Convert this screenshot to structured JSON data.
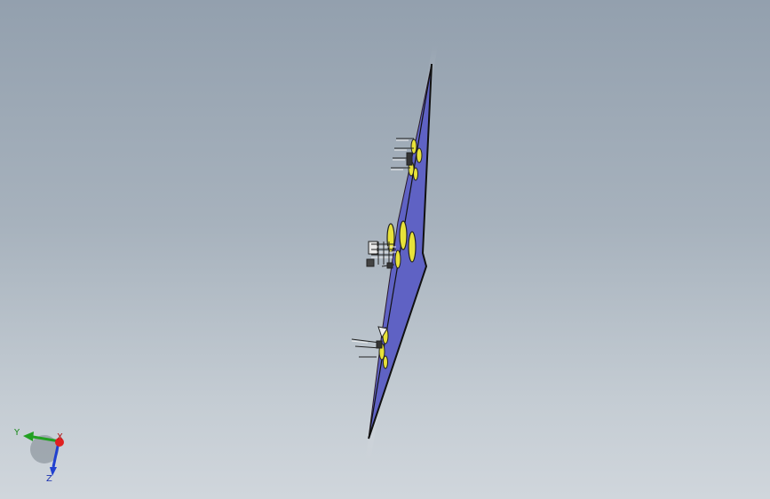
{
  "viewport": {
    "background_top": "#93a0ae",
    "background_bottom": "#d0d6dc"
  },
  "model": {
    "name": "pcb-board",
    "top_face_color": "#c86a6e",
    "bottom_face_color": "#5f62c4",
    "pad_color": "#e8e23a",
    "edge_color": "#111111"
  },
  "triad": {
    "x_label": "X",
    "y_label": "Y",
    "z_label": "Z",
    "x_color": "#e02020",
    "y_color": "#22a022",
    "z_color": "#2040d0"
  }
}
